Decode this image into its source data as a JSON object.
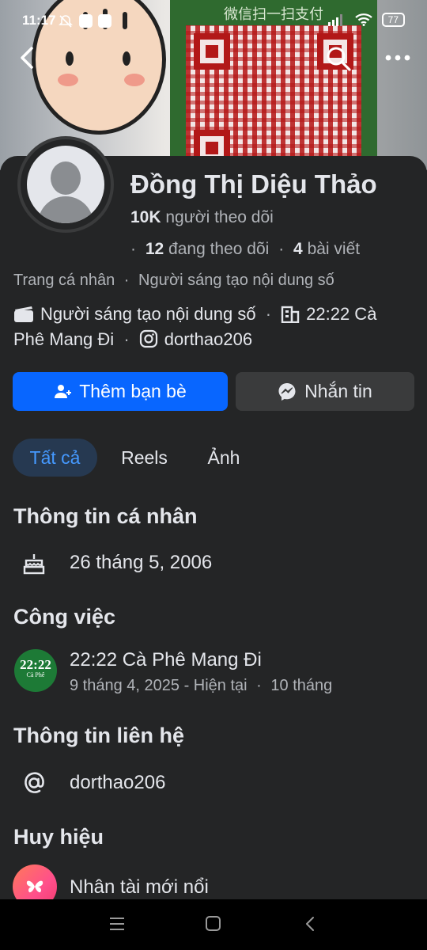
{
  "status_bar": {
    "time": "11:17",
    "battery": "77"
  },
  "cover": {
    "qr_title": "微信扫一扫支付"
  },
  "profile": {
    "name": "Đồng Thị Diệu Thảo",
    "followers_count": "10K",
    "followers_label": "người theo dõi",
    "following_count": "12",
    "following_label": "đang theo dõi",
    "posts_count": "4",
    "posts_label": "bài viết",
    "page_type": "Trang cá nhân",
    "category": "Người sáng tạo nội dung số",
    "detail_category": "Người sáng tạo nội dung số",
    "workplace": "22:22 Cà Phê Mang Đi",
    "instagram": "dorthao206"
  },
  "actions": {
    "add_friend": "Thêm bạn bè",
    "message": "Nhắn tin"
  },
  "tabs": [
    {
      "label": "Tất cả",
      "active": true
    },
    {
      "label": "Reels",
      "active": false
    },
    {
      "label": "Ảnh",
      "active": false
    }
  ],
  "sections": {
    "personal_info": {
      "title": "Thông tin cá nhân",
      "birthday": "26 tháng 5, 2006"
    },
    "work": {
      "title": "Công việc",
      "company": "22:22 Cà Phê Mang Đi",
      "period": "9 tháng 4, 2025 - Hiện tại",
      "duration": "10 tháng",
      "logo_big": "22:22",
      "logo_small": "Cà Phê"
    },
    "contact": {
      "title": "Thông tin liên hệ",
      "username": "dorthao206"
    },
    "badges": {
      "title": "Huy hiệu",
      "badge": "Nhân tài mới nổi"
    }
  },
  "colors": {
    "background": "#242526",
    "primary_button": "#0866ff",
    "secondary_button": "#3a3b3c",
    "active_tab_bg": "#263951",
    "active_tab_text": "#4599ff"
  }
}
